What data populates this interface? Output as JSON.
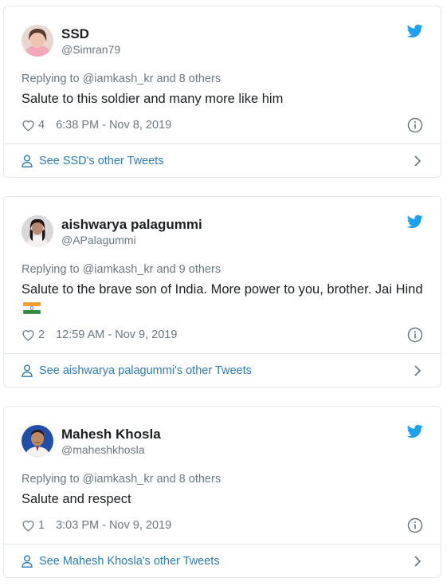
{
  "tweets": [
    {
      "name": "SSD",
      "handle": "@Simran79",
      "replying": "Replying to @iamkash_kr and 8 others",
      "text": "Salute to this soldier and many more like him",
      "text_after": "",
      "likes": "4",
      "timestamp": "6:38 PM - Nov 8, 2019",
      "footer": "See SSD's other Tweets"
    },
    {
      "name": "aishwarya palagummi",
      "handle": "@APalagummi",
      "replying": "Replying to @iamkash_kr and 9 others",
      "text": "Salute to the brave son of India. More power to you, brother.  Jai Hind",
      "text_after": "",
      "likes": "2",
      "timestamp": "12:59 AM - Nov 9, 2019",
      "footer": "See aishwarya palagummi's other Tweets"
    },
    {
      "name": "Mahesh Khosla",
      "handle": "@maheshkhosla",
      "replying": "Replying to @iamkash_kr and 8 others",
      "text": "Salute and respect",
      "text_after": "",
      "likes": "1",
      "timestamp": "3:03 PM - Nov 9, 2019",
      "footer": "See Mahesh Khosla's other Tweets"
    }
  ],
  "icons": {
    "brand": "twitter-bird-icon",
    "like": "heart-icon",
    "info": "info-icon",
    "profile": "person-icon",
    "chevron": "chevron-right-icon",
    "emoji": "india-flag-icon"
  },
  "colors": {
    "twitter_blue": "#1da1f2",
    "link_blue": "#2b7bb9",
    "muted": "#697882",
    "border": "#e1e8ed"
  }
}
